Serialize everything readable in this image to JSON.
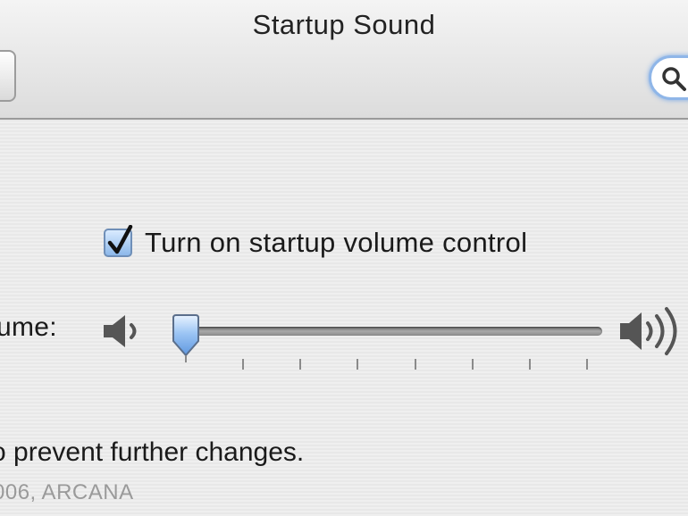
{
  "window": {
    "title": "Startup Sound"
  },
  "toolbar": {
    "back_icon": "back-button",
    "search_icon": "search-icon"
  },
  "startup_volume": {
    "checkbox_label": "Turn on startup volume control",
    "checked": true
  },
  "volume": {
    "label": "ume:",
    "level": 0.0,
    "tick_count": 8,
    "quiet_icon": "speaker-quiet-icon",
    "loud_icon": "speaker-loud-icon"
  },
  "footer": {
    "lock_text": "o prevent further changes.",
    "copyright": "006, ARCANA"
  },
  "colors": {
    "accent_blue": "#8cb8ea",
    "search_glow": "#7aa9e6",
    "thumb_blue": "#7fb1ee"
  }
}
